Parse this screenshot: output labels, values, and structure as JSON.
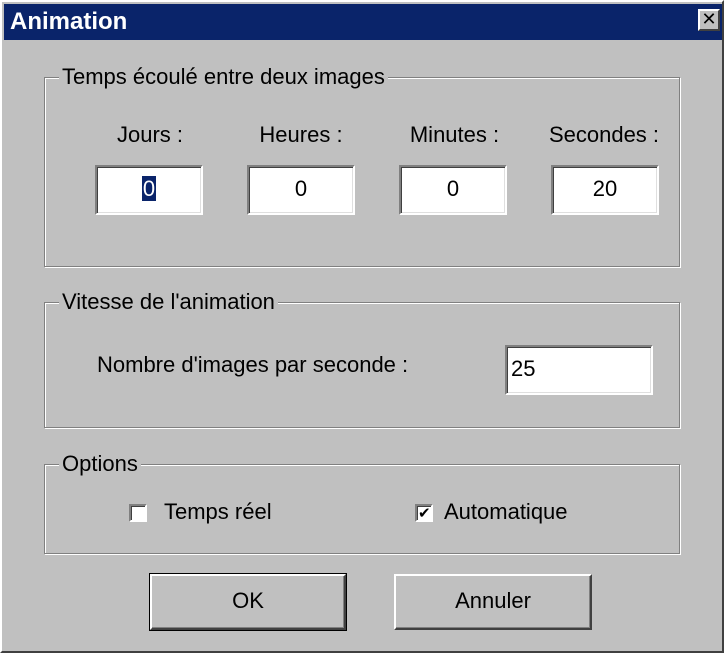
{
  "window": {
    "title": "Animation",
    "close_symbol": "✕"
  },
  "temps": {
    "legend": "Temps écoulé entre deux images",
    "jours_label": "Jours :",
    "jours_value": "0",
    "heures_label": "Heures :",
    "heures_value": "0",
    "minutes_label": "Minutes :",
    "minutes_value": "0",
    "secondes_label": "Secondes :",
    "secondes_value": "20"
  },
  "vitesse": {
    "legend": "Vitesse de l'animation",
    "fps_label": "Nombre d'images par seconde :",
    "fps_value": "25"
  },
  "options": {
    "legend": "Options",
    "temps_reel_label": "Temps réel",
    "temps_reel_checked": false,
    "automatique_label": "Automatique",
    "automatique_checked": true,
    "check_glyph": "✔"
  },
  "buttons": {
    "ok_label": "OK",
    "cancel_label": "Annuler"
  },
  "colors": {
    "titlebar": "#0a246a",
    "face": "#c0c0c0"
  }
}
